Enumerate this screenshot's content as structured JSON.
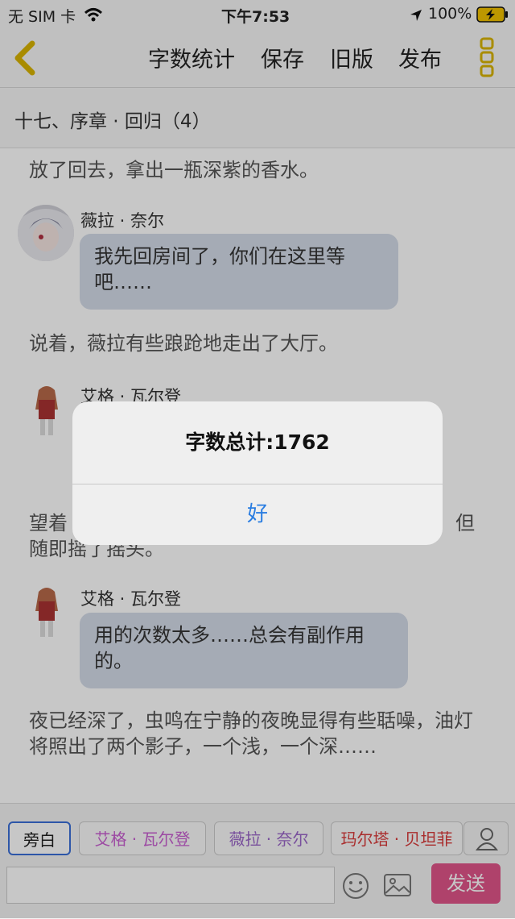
{
  "status": {
    "carrier": "无 SIM 卡",
    "time": "下午7:53",
    "battery": "100%"
  },
  "nav": {
    "word_count": "字数统计",
    "save": "保存",
    "old_version": "旧版",
    "publish": "发布"
  },
  "chapter_title": "十七、序章 · 回归（4）",
  "content": {
    "narr1": "放了回去，拿出一瓶深紫的香水。",
    "speaker1": "薇拉 · 奈尔",
    "bubble1": "我先回房间了，你们在这里等吧……",
    "narr2": "说着，薇拉有些踉跄地走出了大厅。",
    "speaker2": "艾格 · 瓦尔登",
    "narr3a": "望着",
    "narr3b": "但",
    "narr3c": "随即摇了摇头。",
    "speaker3": "艾格 · 瓦尔登",
    "bubble3": "用的次数太多……总会有副作用的。",
    "narr4": "夜已经深了，虫鸣在宁静的夜晚显得有些聒噪，油灯将照出了两个影子，一个浅，一个深……"
  },
  "alert": {
    "message": "字数总计:1762",
    "ok": "好"
  },
  "chips": [
    {
      "label": "旁白",
      "color": "#333333"
    },
    {
      "label": "艾格 · 瓦尔登",
      "color": "#c85fd1"
    },
    {
      "label": "薇拉 · 奈尔",
      "color": "#9a66c8"
    },
    {
      "label": "玛尔塔 · 贝坦菲",
      "color": "#d93a3a"
    }
  ],
  "send_label": "发送",
  "colors": {
    "accent": "#2a7de1",
    "send": "#e0558a",
    "back": "#d9b400"
  },
  "icons": [
    "back-icon",
    "more-icon",
    "person-icon",
    "emoji-icon",
    "image-icon",
    "wifi-icon",
    "location-icon",
    "battery-icon"
  ]
}
